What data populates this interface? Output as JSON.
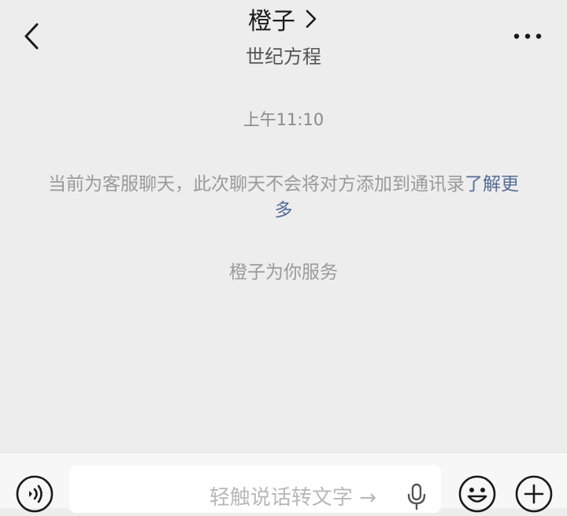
{
  "header": {
    "title": "橙子",
    "subtitle": "世纪方程",
    "back_icon": "back-chevron-icon",
    "title_icon": "chevron-right-icon",
    "more_icon": "more-dots-icon"
  },
  "chat": {
    "timestamp": "上午11:10",
    "notice_text": "当前为客服聊天，此次聊天不会将对方添加到通讯录",
    "notice_link": "了解更多",
    "service_text": "橙子为你服务"
  },
  "input_bar": {
    "hint": "轻触说话转文字",
    "hint_arrow": "→",
    "voice_icon": "voice-icon",
    "mic_icon": "microphone-icon",
    "emoji_icon": "emoji-icon",
    "plus_icon": "plus-icon"
  },
  "colors": {
    "background": "#ededed",
    "link": "#576b95",
    "muted_text": "#9a9a9a"
  }
}
